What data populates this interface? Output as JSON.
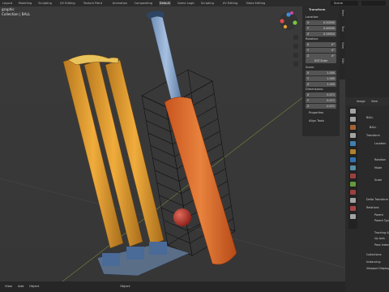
{
  "topbar": {
    "tabs": [
      "Layout",
      "Modeling",
      "Sculpting",
      "UV Editing",
      "Texture Paint",
      "Animation",
      "Compositing",
      "Default",
      "Game Logic",
      "Scripting",
      "UV Editing",
      "Video Editing"
    ],
    "active_tab": "Default",
    "scene_label": "Scene"
  },
  "viewport": {
    "overlay_line1": "graphic",
    "overlay_line2": "Collection | BALL",
    "bottom": {
      "mode": "Object",
      "view": "View",
      "add": "Add",
      "object": "Object"
    }
  },
  "npanel": {
    "header": "Transform",
    "location_label": "Location:",
    "location": [
      {
        "axis": "X",
        "value": "0.20000"
      },
      {
        "axis": "Y",
        "value": "0.00000"
      },
      {
        "axis": "Z",
        "value": "0.33920"
      }
    ],
    "rotation_label": "Rotation:",
    "rotation": [
      {
        "axis": "X",
        "value": "0°"
      },
      {
        "axis": "Y",
        "value": "0°"
      },
      {
        "axis": "Z",
        "value": "0°"
      }
    ],
    "rotation_mode": "XYZ Euler",
    "scale_label": "Scale:",
    "scale": [
      {
        "axis": "X",
        "value": "1.000"
      },
      {
        "axis": "Y",
        "value": "1.000"
      },
      {
        "axis": "Z",
        "value": "1.000"
      }
    ],
    "dimensions_label": "Dimensions:",
    "dimensions": [
      {
        "axis": "X",
        "value": "0.071"
      },
      {
        "axis": "Y",
        "value": "0.071"
      },
      {
        "axis": "Z",
        "value": "0.071"
      }
    ],
    "properties_label": "Properties",
    "align_label": "Align Tools",
    "side_tabs": [
      "Item",
      "Tool",
      "View",
      "Edit"
    ]
  },
  "properties": {
    "object_name": "BALL",
    "object_name2": "BALL",
    "rows": [
      "Transform",
      "Location",
      "Rotation",
      "Mode",
      "Scale",
      "Delta Transform",
      "Relations",
      "Parent",
      "Parent Type",
      "Tracking Axis",
      "Up Axis",
      "Pass Index",
      "Collections",
      "Instancing",
      "Viewport Display"
    ],
    "header_labels": [
      "Image",
      "View"
    ]
  }
}
